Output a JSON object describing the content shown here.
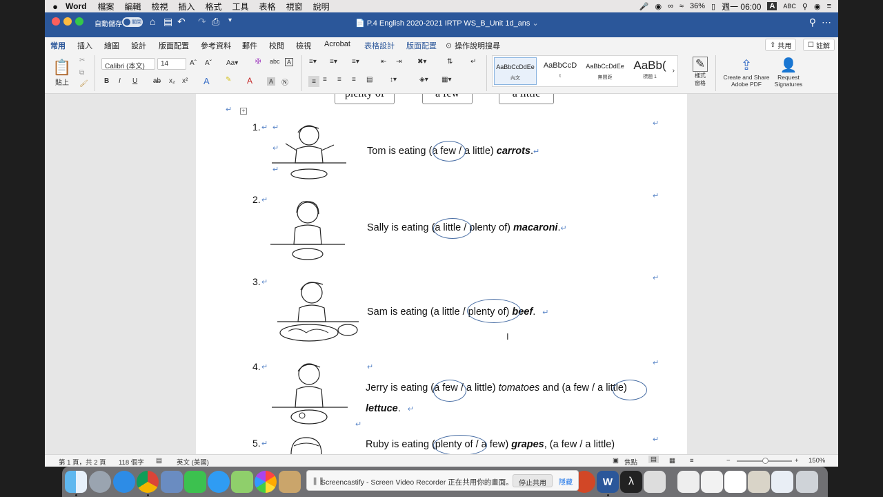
{
  "menubar": {
    "apple": "",
    "app": "Word",
    "items": [
      "檔案",
      "編輯",
      "檢視",
      "插入",
      "格式",
      "工具",
      "表格",
      "視窗",
      "說明"
    ],
    "battery": "36%",
    "clock": "週一 06:00",
    "input_badge": "A",
    "input_label": "ABC"
  },
  "titlebar": {
    "autosave_label": "自動儲存",
    "autosave_state": "關閉",
    "doc_title": "P.4 English 2020-2021 IRTP WS_B_Unit 1d_ans"
  },
  "tabs": {
    "items": [
      "常用",
      "插入",
      "繪圖",
      "設計",
      "版面配置",
      "參考資料",
      "郵件",
      "校閱",
      "檢視",
      "Acrobat",
      "表格設計",
      "版面配置"
    ],
    "tell_me": "操作說明搜尋",
    "share": "共用",
    "comment": "註解"
  },
  "ribbon": {
    "paste": "貼上",
    "font_name": "Calibri (本文)",
    "font_size": "14",
    "styles": [
      {
        "preview": "AaBbCcDdEe",
        "name": "內文"
      },
      {
        "preview": "AaBbCcD",
        "name": "t"
      },
      {
        "preview": "AaBbCcDdEe",
        "name": "無間距"
      },
      {
        "preview": "AaBb(",
        "name": "標題 1"
      }
    ],
    "styles_pane": "樣式\n窗格",
    "create_share": "Create and Share\nAdobe PDF",
    "request_signatures": "Request\nSignatures"
  },
  "document": {
    "word_boxes": [
      "plenty of",
      "a few",
      "a little"
    ],
    "items": [
      {
        "num": "1.",
        "subject": "Tom is eating (",
        "opt1": "a few",
        "mid": " / a little) ",
        "noun": "carrots",
        "tail": "."
      },
      {
        "num": "2.",
        "subject": "Sally is eating (",
        "opt1": "a little",
        "mid": " / plenty of) ",
        "noun": "macaroni",
        "tail": "."
      },
      {
        "num": "3.",
        "subject": "Sam is eating (a little / ",
        "opt1": "plenty of",
        "mid": ") ",
        "noun": "beef",
        "tail": "."
      },
      {
        "num": "4.",
        "subject": "Jerry is eating (",
        "opt1": "a few",
        "mid": " / a little) ",
        "noun": "tomatoes",
        "tail": " and (a few / ",
        "opt2": "a little",
        "tail2": ")",
        "line2": "lettuce",
        "line2tail": "."
      },
      {
        "num": "5.",
        "subject": "Ruby is eating (",
        "opt1": "plenty of",
        "mid": " / a few) ",
        "noun": "grapes",
        "tail": ", (a few / a little)"
      }
    ]
  },
  "statusbar": {
    "page": "第 1 頁，共 2 頁",
    "words": "118 個字",
    "language": "英文 (美國)",
    "focus": "焦點",
    "zoom": "150%"
  },
  "screencast": {
    "message": "Screencastify - Screen Video Recorder 正在共用你的畫面。",
    "stop": "停止共用",
    "hide": "隱藏"
  }
}
